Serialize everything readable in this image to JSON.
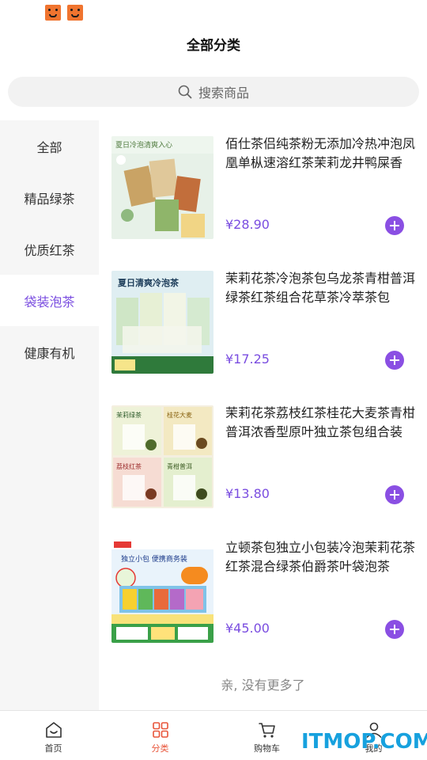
{
  "header": {
    "title": "全部分类"
  },
  "search": {
    "placeholder": "搜索商品"
  },
  "sidebar": {
    "items": [
      {
        "label": "全部",
        "active": false
      },
      {
        "label": "精品绿茶",
        "active": false
      },
      {
        "label": "优质红茶",
        "active": false
      },
      {
        "label": "袋装泡茶",
        "active": true
      },
      {
        "label": "健康有机",
        "active": false
      }
    ]
  },
  "products": [
    {
      "name": "佰仕茶侣纯茶粉无添加冷热冲泡凤凰单枞速溶红茶茉莉龙井鸭屎香",
      "price": "¥28.90",
      "thumb_text": "夏日冷泡清爽入心"
    },
    {
      "name": "茉莉花茶冷泡茶包乌龙茶青柑普洱绿茶红茶组合花草茶冷萃茶包",
      "price": "¥17.25",
      "thumb_text": "夏日清爽冷泡茶"
    },
    {
      "name": "茉莉花茶荔枝红茶桂花大麦茶青柑普洱浓香型原叶独立茶包组合装",
      "price": "¥13.80",
      "thumb_text": "荔枝红茶"
    },
    {
      "name": "立顿茶包独立小包装冷泡茉莉花茶红茶混合绿茶伯爵茶叶袋泡茶",
      "price": "¥45.00",
      "thumb_text": "独立小包 便携商务装"
    }
  ],
  "list_end": {
    "text": "亲, 没有更多了"
  },
  "tabbar": {
    "items": [
      {
        "label": "首页",
        "active": false
      },
      {
        "label": "分类",
        "active": true
      },
      {
        "label": "购物车",
        "active": false
      },
      {
        "label": "我的",
        "active": false
      }
    ]
  },
  "watermark": {
    "text": "ITMOP.COM"
  },
  "colors": {
    "accent": "#7a4de0",
    "tab_active": "#e8553a",
    "watermark": "#17a1de"
  }
}
